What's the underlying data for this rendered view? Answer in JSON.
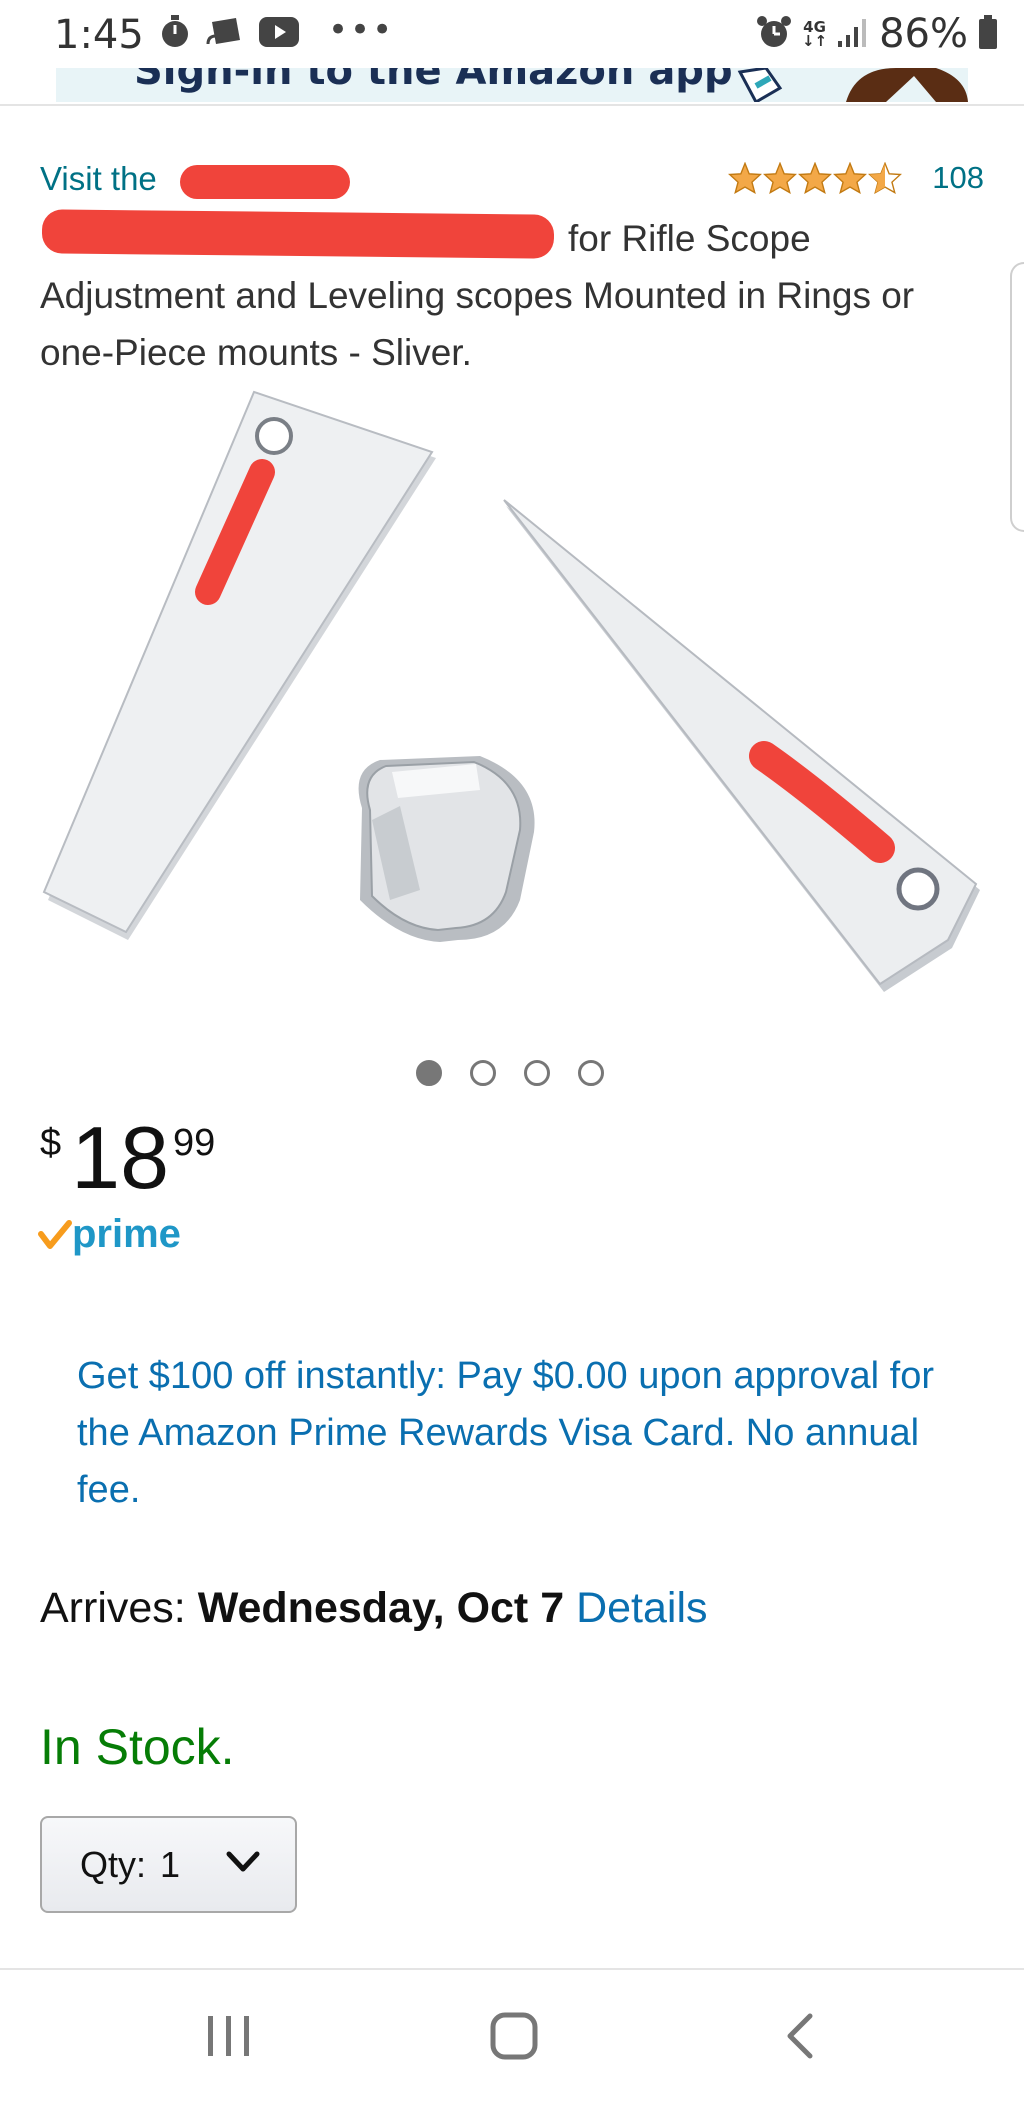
{
  "status_bar": {
    "time": "1:45",
    "network": "4G",
    "battery": "86%"
  },
  "banner": {
    "text": "Sign-in to the Amazon app"
  },
  "product": {
    "brand_prefix": "Visit the",
    "rating_count": "108",
    "rating_stars": 4.5,
    "title_visible_first": "for Rifle Scope",
    "title_rest": "Adjustment and Leveling scopes Mounted in Rings or one-Piece mounts - Sliver."
  },
  "carousel": {
    "count": 4,
    "active": 0
  },
  "price": {
    "symbol": "$",
    "whole": "18",
    "fraction": "99"
  },
  "prime_label": "prime",
  "promo_text": "Get $100 off instantly: Pay $0.00 upon approval for the Amazon Prime Rewards Visa Card. No annual fee.",
  "delivery": {
    "label": "Arrives:",
    "date": "Wednesday, Oct 7",
    "details_link": "Details"
  },
  "stock_status": "In Stock.",
  "quantity": {
    "label": "Qty:",
    "value": "1"
  },
  "colors": {
    "link": "#007185",
    "promo_link": "#0a6fb0",
    "in_stock": "#067d06",
    "star": "#f3a847",
    "prime": "#1f97c7",
    "redaction": "#f0443b"
  },
  "icons": {
    "status_left": [
      "stopwatch-icon",
      "cast-icon",
      "youtube-icon",
      "more-dots-icon"
    ],
    "status_right": [
      "alarm-icon",
      "signal-icon",
      "battery-icon"
    ],
    "nav": [
      "recent-apps-icon",
      "home-icon",
      "back-icon"
    ]
  }
}
